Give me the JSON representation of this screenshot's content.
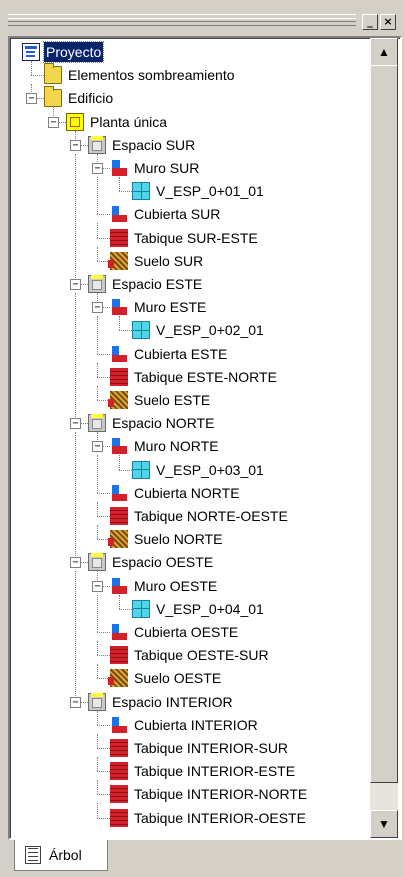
{
  "window": {
    "minimize_label": "_",
    "close_label": "×"
  },
  "tree": {
    "nodes": [
      {
        "label": "Proyecto",
        "level": 0,
        "icon": "project-icon",
        "expander": "none",
        "selected": true
      },
      {
        "label": "Elementos sombreamiento",
        "level": 1,
        "icon": "folder-icon",
        "expander": "none"
      },
      {
        "label": "Edificio",
        "level": 1,
        "icon": "folder-icon",
        "expander": "minus"
      },
      {
        "label": "Planta única",
        "level": 2,
        "icon": "floor-plan-icon",
        "expander": "minus"
      },
      {
        "label": "Espacio SUR",
        "level": 3,
        "icon": "space-icon",
        "expander": "minus"
      },
      {
        "label": "Muro SUR",
        "level": 4,
        "icon": "wall-icon",
        "expander": "minus"
      },
      {
        "label": "V_ESP_0+01_01",
        "level": 5,
        "icon": "window-icon",
        "expander": "none"
      },
      {
        "label": "Cubierta SUR",
        "level": 4,
        "icon": "roof-icon",
        "expander": "none"
      },
      {
        "label": "Tabique SUR-ESTE",
        "level": 4,
        "icon": "partition-icon",
        "expander": "none"
      },
      {
        "label": "Suelo SUR",
        "level": 4,
        "icon": "floor-icon",
        "expander": "none"
      },
      {
        "label": "Espacio ESTE",
        "level": 3,
        "icon": "space-icon",
        "expander": "minus"
      },
      {
        "label": "Muro ESTE",
        "level": 4,
        "icon": "wall-icon",
        "expander": "minus"
      },
      {
        "label": "V_ESP_0+02_01",
        "level": 5,
        "icon": "window-icon",
        "expander": "none"
      },
      {
        "label": "Cubierta ESTE",
        "level": 4,
        "icon": "roof-icon",
        "expander": "none"
      },
      {
        "label": "Tabique ESTE-NORTE",
        "level": 4,
        "icon": "partition-icon",
        "expander": "none"
      },
      {
        "label": "Suelo ESTE",
        "level": 4,
        "icon": "floor-icon",
        "expander": "none"
      },
      {
        "label": "Espacio NORTE",
        "level": 3,
        "icon": "space-icon",
        "expander": "minus"
      },
      {
        "label": "Muro NORTE",
        "level": 4,
        "icon": "wall-icon",
        "expander": "minus"
      },
      {
        "label": "V_ESP_0+03_01",
        "level": 5,
        "icon": "window-icon",
        "expander": "none"
      },
      {
        "label": "Cubierta NORTE",
        "level": 4,
        "icon": "roof-icon",
        "expander": "none"
      },
      {
        "label": "Tabique NORTE-OESTE",
        "level": 4,
        "icon": "partition-icon",
        "expander": "none"
      },
      {
        "label": "Suelo NORTE",
        "level": 4,
        "icon": "floor-icon",
        "expander": "none"
      },
      {
        "label": "Espacio OESTE",
        "level": 3,
        "icon": "space-icon",
        "expander": "minus"
      },
      {
        "label": "Muro OESTE",
        "level": 4,
        "icon": "wall-icon",
        "expander": "minus"
      },
      {
        "label": "V_ESP_0+04_01",
        "level": 5,
        "icon": "window-icon",
        "expander": "none"
      },
      {
        "label": "Cubierta OESTE",
        "level": 4,
        "icon": "roof-icon",
        "expander": "none"
      },
      {
        "label": "Tabique OESTE-SUR",
        "level": 4,
        "icon": "partition-icon",
        "expander": "none"
      },
      {
        "label": "Suelo OESTE",
        "level": 4,
        "icon": "floor-icon",
        "expander": "none"
      },
      {
        "label": "Espacio INTERIOR",
        "level": 3,
        "icon": "space-icon",
        "expander": "minus"
      },
      {
        "label": "Cubierta INTERIOR",
        "level": 4,
        "icon": "roof-icon",
        "expander": "none"
      },
      {
        "label": "Tabique INTERIOR-SUR",
        "level": 4,
        "icon": "partition-icon",
        "expander": "none"
      },
      {
        "label": "Tabique INTERIOR-ESTE",
        "level": 4,
        "icon": "partition-icon",
        "expander": "none"
      },
      {
        "label": "Tabique INTERIOR-NORTE",
        "level": 4,
        "icon": "partition-icon",
        "expander": "none"
      },
      {
        "label": "Tabique INTERIOR-OESTE",
        "level": 4,
        "icon": "partition-icon",
        "expander": "none"
      }
    ]
  },
  "scrollbar": {
    "up_arrow": "▲",
    "down_arrow": "▼"
  },
  "tabs": [
    {
      "label": "Árbol",
      "icon": "tree-view-icon",
      "active": true
    }
  ],
  "colors": {
    "selection": "#0a246a",
    "panel": "#d4d0c8"
  }
}
